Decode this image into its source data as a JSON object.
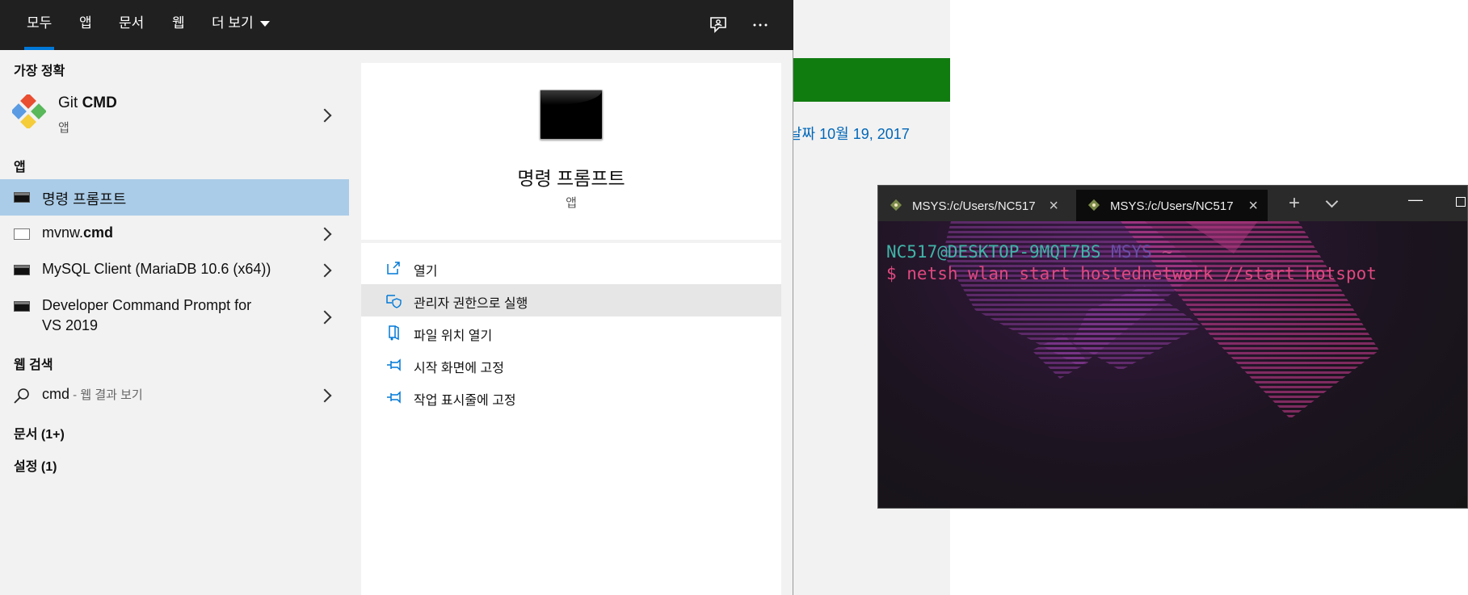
{
  "background": {
    "date_text": "날짜 10월 19, 2017"
  },
  "start_menu": {
    "tabs": [
      {
        "label": "모두",
        "active": true
      },
      {
        "label": "앱"
      },
      {
        "label": "문서"
      },
      {
        "label": "웹"
      },
      {
        "label": "더 보기"
      }
    ],
    "sections": {
      "best_match": "가장 정확",
      "apps": "앱",
      "web_search": "웹 검색",
      "documents": "문서 (1+)",
      "settings": "설정 (1)"
    },
    "best_match": {
      "name_prefix": "Git ",
      "name_bold": "CMD",
      "type": "앱"
    },
    "apps": [
      {
        "label": "명령 프롬프트",
        "selected": true
      },
      {
        "label_prefix": "mvnw.",
        "label_bold": "cmd"
      },
      {
        "label": "MySQL Client (MariaDB 10.6 (x64))"
      },
      {
        "label_line1": "Developer Command Prompt for",
        "label_line2": "VS 2019"
      }
    ],
    "web_result": {
      "query": "cmd",
      "suffix": " - 웹 결과 보기"
    },
    "detail": {
      "title": "명령 프롬프트",
      "subtitle": "앱",
      "actions": [
        {
          "label": "열기",
          "icon": "open-icon"
        },
        {
          "label": "관리자 권한으로 실행",
          "icon": "admin-shield-icon",
          "highlighted": true
        },
        {
          "label": "파일 위치 열기",
          "icon": "file-location-icon"
        },
        {
          "label": "시작 화면에 고정",
          "icon": "pin-icon"
        },
        {
          "label": "작업 표시줄에 고정",
          "icon": "pin-icon"
        }
      ]
    }
  },
  "terminal": {
    "tabs": [
      {
        "title": "MSYS:/c/Users/NC517"
      },
      {
        "title": "MSYS:/c/Users/NC517",
        "active": true
      }
    ],
    "prompt": {
      "user_host": "NC517@DESKTOP-9MQT7BS",
      "env": "MSYS",
      "path": "~"
    },
    "command": "$ netsh wlan start hostednetwork //start hotspot",
    "colors": {
      "user_host": "#3fb5a8",
      "env": "#6a4ea8",
      "path": "#c44d8c",
      "command": "#e0487f"
    }
  }
}
